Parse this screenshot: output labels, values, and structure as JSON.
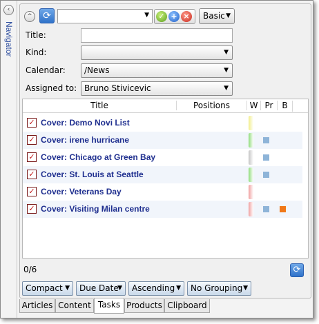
{
  "navigator": {
    "label": "Navigator",
    "collapse_glyph": "‹"
  },
  "toolbar": {
    "collapse_glyph": "^",
    "refresh_glyph": "⟳",
    "search_value": "",
    "combo_arrow": "▼",
    "ok_glyph": "✓",
    "add_glyph": "+",
    "delete_glyph": "×",
    "mode_label": "Basic"
  },
  "form": {
    "title_label": "Title:",
    "title_value": "",
    "kind_label": "Kind:",
    "kind_value": "",
    "calendar_label": "Calendar:",
    "calendar_value": "/News",
    "assigned_label": "Assigned to:",
    "assigned_value": "Bruno Stivicevic"
  },
  "table": {
    "headers": {
      "title": "Title",
      "positions": "Positions",
      "w": "W",
      "pr": "Pr",
      "b": "B"
    },
    "rows": [
      {
        "title": "Cover: Demo Novi List",
        "w_color": "#f2ee8a",
        "pr": false,
        "b": false
      },
      {
        "title": "Cover: irene hurricane",
        "w_color": "#8fdc7a",
        "pr": true,
        "b": false
      },
      {
        "title": "Cover: Chicago at Green Bay",
        "w_color": "#c4c4c4",
        "pr": true,
        "b": false
      },
      {
        "title": "Cover: St. Louis at Seattle",
        "w_color": "#8fdc7a",
        "pr": true,
        "b": false
      },
      {
        "title": "Cover: Veterans Day",
        "w_color": "#f0a0a0",
        "pr": false,
        "b": false
      },
      {
        "title": "Cover: Visiting Milan centre",
        "w_color": "#f0a0a0",
        "pr": true,
        "b": true
      }
    ],
    "task_glyph": "✓"
  },
  "footer": {
    "counter": "0/6",
    "refresh_glyph": "⟳",
    "filters": [
      "Compact",
      "Due Date",
      "Ascending",
      "No Grouping"
    ],
    "filter_arrow": "▼"
  },
  "tabs": [
    "Articles",
    "Content",
    "Tasks",
    "Products",
    "Clipboard"
  ],
  "active_tab": "Tasks"
}
